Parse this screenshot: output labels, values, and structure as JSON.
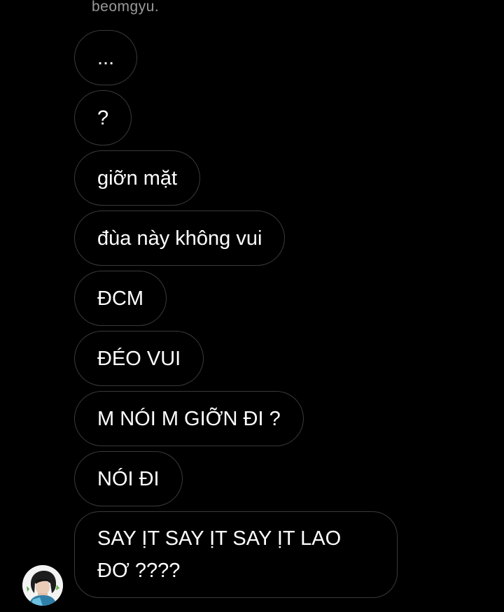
{
  "sender": {
    "name": "beomgyu."
  },
  "messages": [
    {
      "text": "..."
    },
    {
      "text": "?"
    },
    {
      "text": "giỡn mặt"
    },
    {
      "text": "đùa này không vui"
    },
    {
      "text": "ĐCM"
    },
    {
      "text": "ĐÉO VUI"
    },
    {
      "text": "M NÓI M GIỠN ĐI ?"
    },
    {
      "text": "NÓI ĐI"
    },
    {
      "text": "SAY ỊT SAY ỊT SAY ỊT LAO ĐƠ ????"
    }
  ],
  "avatar": {
    "icon": "profile-avatar"
  }
}
